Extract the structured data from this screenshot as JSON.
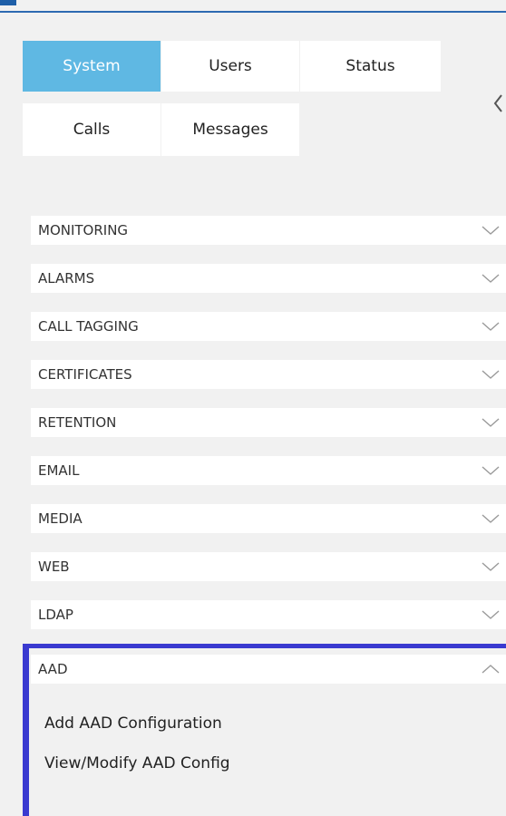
{
  "tabs": [
    {
      "label": "System",
      "active": true
    },
    {
      "label": "Users",
      "active": false
    },
    {
      "label": "Status",
      "active": false
    },
    {
      "label": "Calls",
      "active": false
    },
    {
      "label": "Messages",
      "active": false
    }
  ],
  "collapse_icon": "chevron-left-icon",
  "accordion": [
    {
      "label": "MONITORING",
      "icon": "chevron-down-icon"
    },
    {
      "label": "ALARMS",
      "icon": "chevron-down-icon"
    },
    {
      "label": "CALL TAGGING",
      "icon": "chevron-down-icon"
    },
    {
      "label": "CERTIFICATES",
      "icon": "chevron-down-icon"
    },
    {
      "label": "RETENTION",
      "icon": "chevron-down-icon"
    },
    {
      "label": "EMAIL",
      "icon": "chevron-down-icon"
    },
    {
      "label": "MEDIA",
      "icon": "chevron-down-icon"
    },
    {
      "label": "WEB",
      "icon": "chevron-down-icon"
    },
    {
      "label": "LDAP",
      "icon": "chevron-down-icon"
    },
    {
      "label": "AAD",
      "icon": "chevron-up-icon",
      "expanded": true
    }
  ],
  "aad_links": [
    {
      "label": "Add AAD Configuration"
    },
    {
      "label": "View/Modify AAD Config"
    }
  ],
  "colors": {
    "active_tab": "#5fb8e3",
    "focus_border": "#3a3ad0",
    "header_rule": "#2d6ab1",
    "background": "#f1f1f1"
  }
}
